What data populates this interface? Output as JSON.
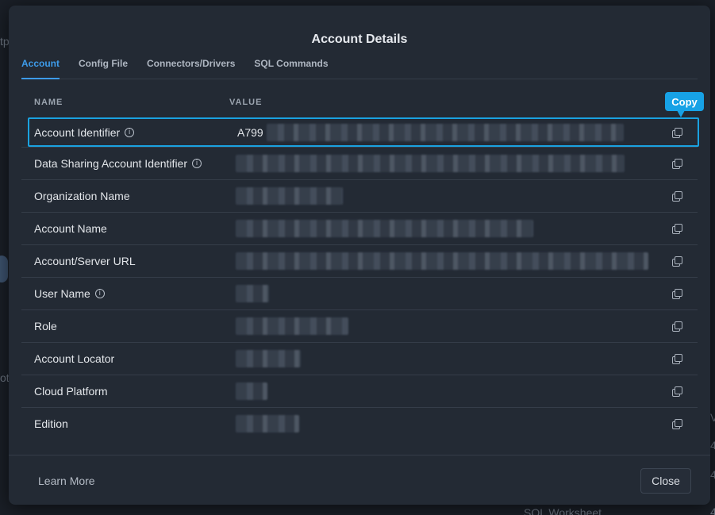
{
  "background": {
    "frag_top": "tp",
    "frag_mid": "ot",
    "frag_right1": "V",
    "frag_right2": "4",
    "frag_right3": "4",
    "frag_right4": "4",
    "frag_bottom": "SQL Worksheet"
  },
  "modal": {
    "title": "Account Details",
    "tabs": [
      {
        "label": "Account",
        "active": true
      },
      {
        "label": "Config File"
      },
      {
        "label": "Connectors/Drivers"
      },
      {
        "label": "SQL Commands"
      }
    ],
    "columns": {
      "name": "NAME",
      "value": "VALUE"
    },
    "rows": [
      {
        "name": "Account Identifier",
        "info": true,
        "value": "A799"
      },
      {
        "name": "Data Sharing Account Identifier",
        "info": true,
        "value": ""
      },
      {
        "name": "Organization Name",
        "value": ""
      },
      {
        "name": "Account Name",
        "value": ""
      },
      {
        "name": "Account/Server URL",
        "value": ""
      },
      {
        "name": "User Name",
        "info": true,
        "value": ""
      },
      {
        "name": "Role",
        "value": ""
      },
      {
        "name": "Account Locator",
        "value": ""
      },
      {
        "name": "Cloud Platform",
        "value": ""
      },
      {
        "name": "Edition",
        "value": ""
      }
    ],
    "tooltip": "Copy",
    "learn_more": "Learn More",
    "close": "Close"
  },
  "icons": {
    "info": "info-icon",
    "copy": "copy-icon"
  },
  "colors": {
    "accent": "#3d9be9",
    "selection": "#1aa2e0",
    "tooltip": "#17a2e6"
  }
}
